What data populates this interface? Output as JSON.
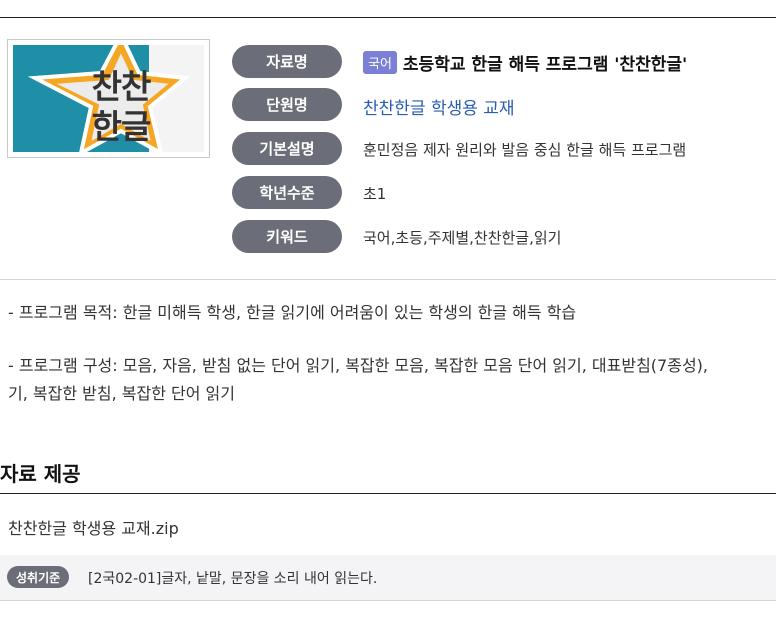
{
  "thumbnail": {
    "line1": "찬찬",
    "line2": "한글",
    "icon": "star-logo-image"
  },
  "info": [
    {
      "label": "자료명",
      "badge": "국어",
      "value": "초등학교 한글 해득 프로그램 '찬찬한글'"
    },
    {
      "label": "단원명",
      "value": "찬찬한글 학생용 교재"
    },
    {
      "label": "기본설명",
      "value": "훈민정음 제자 원리와 발음 중심 한글 해득 프로그램"
    },
    {
      "label": "학년수준",
      "value": "초1"
    },
    {
      "label": "키워드",
      "value": "국어,초등,주제별,찬찬한글,읽기"
    }
  ],
  "description": {
    "purpose": "- 프로그램 목적: 한글 미해득 학생, 한글 읽기에 어려움이 있는 학생의 한글 해득 학습",
    "composition_line1": "- 프로그램 구성: 모음, 자음, 받침 없는 단어 읽기, 복잡한 모음, 복잡한 모음 단어 읽기, 대표받침(7종성),",
    "composition_line2": "기, 복잡한 받침, 복잡한 단어 읽기"
  },
  "section": {
    "title": "자료 제공"
  },
  "file": {
    "name": "찬찬한글 학생용 교재.zip"
  },
  "standard": {
    "badge": "성취기준",
    "text": "[2국02-01]글자, 낱말, 문장을 소리 내어 읽는다."
  },
  "colors": {
    "pill": "#6b6e78",
    "subject_badge": "#7b80d6",
    "link": "#2a5db0",
    "thumb_bg": "#1e8fa6",
    "star_outline": "#f5a623"
  }
}
